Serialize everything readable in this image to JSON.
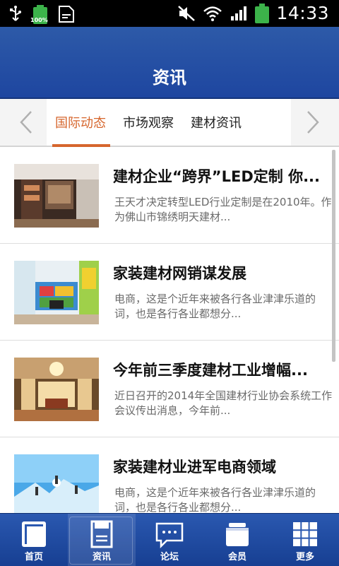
{
  "status_bar": {
    "battery_left_label": "100%",
    "time": "14:33",
    "icons": [
      "usb-icon",
      "battery-icon",
      "sim-icon",
      "mute-icon",
      "wifi-icon",
      "signal-icon",
      "battery-icon"
    ]
  },
  "header": {
    "title": "资讯"
  },
  "tabs": [
    {
      "label": "国际动态",
      "active": true
    },
    {
      "label": "市场观察",
      "active": false
    },
    {
      "label": "建材资讯",
      "active": false
    }
  ],
  "articles": [
    {
      "title": "建材企业“跨界”LED定制 你...",
      "desc": "王天才决定转型LED行业定制是在2010年。作为佛山市锦绣明天建材..."
    },
    {
      "title": "家装建材网销谋发展",
      "desc": "电商，这是个近年来被各行各业津津乐道的词，也是各行各业都想分..."
    },
    {
      "title": "今年前三季度建材工业增幅...",
      "desc": "近日召开的2014年全国建材行业协会系统工作会议传出消息，今年前..."
    },
    {
      "title": "家装建材业进军电商领域",
      "desc": "电商，这是个近年来被各行各业津津乐道的词，也是各行各业都想分..."
    }
  ],
  "bottom_nav": [
    {
      "label": "首页",
      "icon": "home-icon"
    },
    {
      "label": "资讯",
      "icon": "news-icon",
      "active": true
    },
    {
      "label": "论坛",
      "icon": "forum-icon"
    },
    {
      "label": "会员",
      "icon": "member-icon"
    },
    {
      "label": "更多",
      "icon": "more-icon"
    }
  ],
  "colors": {
    "header_blue": "#1e46a0",
    "tab_active": "#d6662d"
  }
}
